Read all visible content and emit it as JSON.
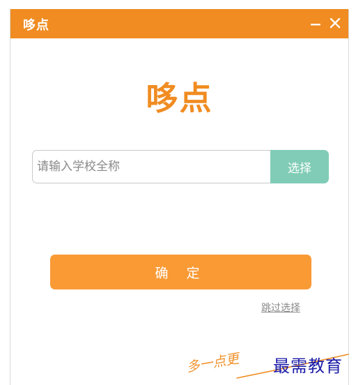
{
  "window": {
    "title": "哆点",
    "minimize_glyph": "—",
    "close_glyph": "✕"
  },
  "logo": {
    "text": "哆点"
  },
  "school": {
    "placeholder": "请输入学校全称",
    "select_label": "选择"
  },
  "actions": {
    "confirm_label": "确 定",
    "skip_label": "跳过选择"
  },
  "watermark": {
    "script_text": "多一点更",
    "brand_text": "最需教育"
  },
  "colors": {
    "titlebar": "#f08c21",
    "logo": "#f08c21",
    "select_button": "#80ccb6",
    "confirm_button": "#f99a35",
    "watermark_brand": "#1a1aa8"
  },
  "icons": {
    "minimize": "minimize-icon",
    "close": "close-icon"
  }
}
